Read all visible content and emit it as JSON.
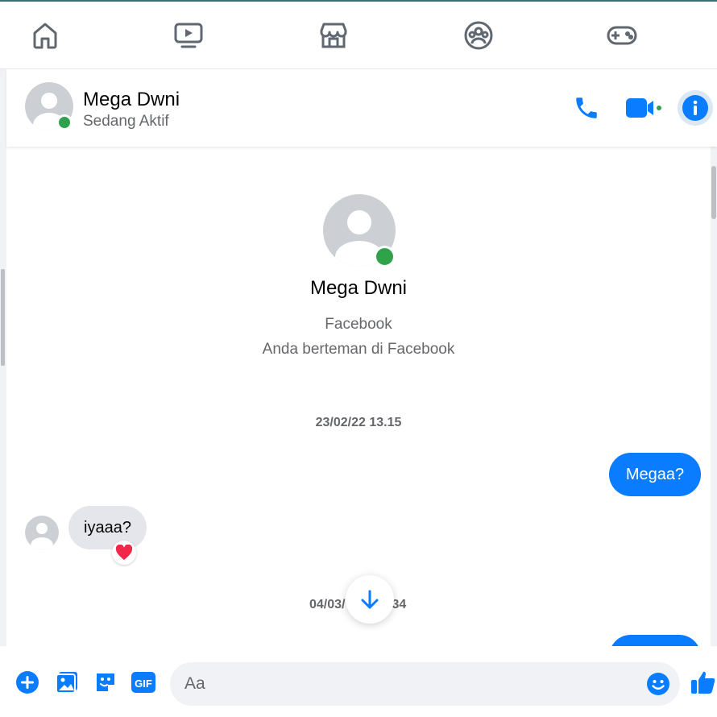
{
  "nav": {
    "items": [
      {
        "icon": "home-icon"
      },
      {
        "icon": "watch-icon"
      },
      {
        "icon": "marketplace-icon"
      },
      {
        "icon": "groups-icon"
      },
      {
        "icon": "gaming-icon"
      }
    ]
  },
  "chat_header": {
    "name": "Mega Dwni",
    "status": "Sedang Aktif"
  },
  "profile": {
    "name": "Mega Dwni",
    "platform": "Facebook",
    "relation": "Anda berteman di Facebook"
  },
  "messages": {
    "timestamp_1": "23/02/22 13.15",
    "outgoing_1": "Megaa?",
    "incoming_1": "iyaaa?",
    "reaction_1": "heart",
    "timestamp_2_left": "04/03/",
    "timestamp_2_right": ".34"
  },
  "composer": {
    "placeholder": "Aa"
  },
  "colors": {
    "accent": "#0a7cff",
    "active_green": "#31a24c",
    "bubble_in": "#e4e6eb",
    "reaction_red": "#f0284a"
  }
}
